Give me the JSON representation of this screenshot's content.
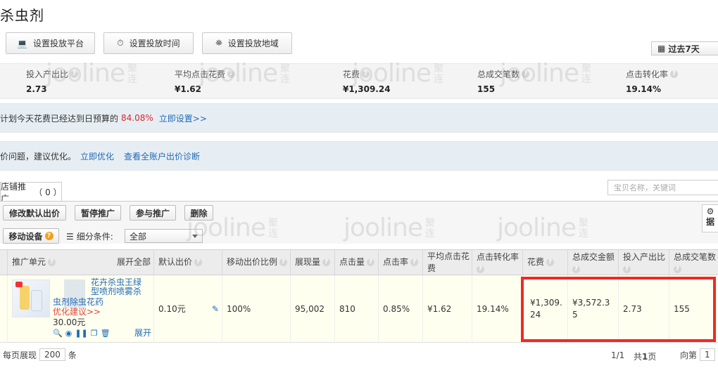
{
  "page_title": "杀虫剂",
  "toolbar": {
    "platform_label": "设置投放平台",
    "time_label": "设置投放时间",
    "region_label": "设置投放地域",
    "date_range_label": "过去7天"
  },
  "stats": [
    {
      "label": "投入产出比",
      "value": "2.73"
    },
    {
      "label": "平均点击花费",
      "value": "¥1.62"
    },
    {
      "label": "花费",
      "value": "¥1,309.24"
    },
    {
      "label": "总成交笔数",
      "value": "155"
    },
    {
      "label": "点击转化率",
      "value": "19.14%"
    }
  ],
  "notice_budget": {
    "text": "计划今天花费已经达到日预算的",
    "percent": "84.08%",
    "link": "立即设置>>"
  },
  "notice_bid": {
    "text": "价问题，建议优化。",
    "link1": "立即优化",
    "link2": "查看全账户出价诊断"
  },
  "tab": {
    "label": "店铺推广",
    "count": "（ 0 ）"
  },
  "search": {
    "placeholder": "宝贝名称，关键词"
  },
  "actions": {
    "edit_bid": "修改默认出价",
    "pause": "暂停推广",
    "join": "参与推广",
    "delete": "删除",
    "mobile": "移动设备",
    "mobile_badge": "?",
    "filter_label": "细分条件:",
    "filter_value": "全部",
    "settings_label": "据"
  },
  "watermark": {
    "brand": "jooline",
    "cn": "聚连"
  },
  "table": {
    "headers": {
      "unit": "推广单元",
      "expand_all": "展开全部",
      "default_bid": "默认出价",
      "mobile_ratio": "移动出价比例",
      "impressions": "展现量",
      "clicks": "点击量",
      "ctr": "点击率",
      "avg_cpc": "平均点击花费",
      "cvr": "点击转化率",
      "cost": "花费",
      "gmv": "总成交金额",
      "roi": "投入产出比",
      "orders": "总成交笔数"
    },
    "row": {
      "title_line1": "花卉杀虫王绿",
      "title_line2": "型喷剂喷雾杀",
      "title_line3": "虫剂除虫花药",
      "suggest": "优化建议>>",
      "price": "30.00元",
      "expand": "展开",
      "default_bid": "0.10元",
      "mobile_ratio": "100%",
      "impressions": "95,002",
      "clicks": "810",
      "ctr": "0.85%",
      "avg_cpc": "¥1.62",
      "cvr": "19.14%",
      "cost": "¥1,309.24",
      "gmv": "¥3,572.35",
      "roi": "2.73",
      "orders": "155"
    }
  },
  "footer": {
    "per_page_label": "每页展现",
    "per_page_value": "200",
    "per_page_unit": "条",
    "page_info": "1/1",
    "total_label": "共",
    "total_value": "1",
    "total_unit": "页",
    "goto_label": "向第",
    "goto_value": "1"
  }
}
